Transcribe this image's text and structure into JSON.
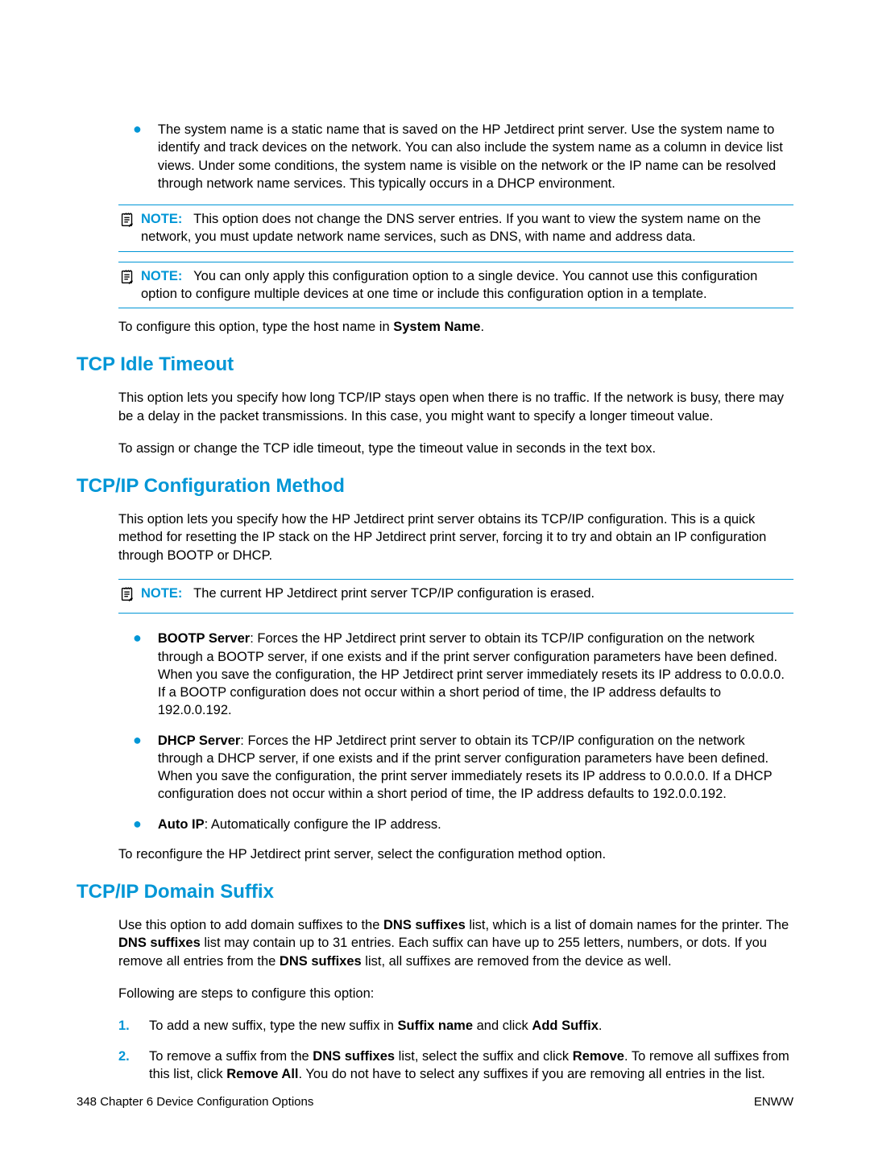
{
  "intro_bullet": "The system name is a static name that is saved on the HP Jetdirect print server. Use the system name to identify and track devices on the network. You can also include the system name as a column in device list views. Under some conditions, the system name is visible on the network or the IP name can be resolved through network name services. This typically occurs in a DHCP environment.",
  "note1_label": "NOTE:",
  "note1_text": "This option does not change the DNS server entries. If you want to view the system name on the network, you must update network name services, such as DNS, with name and address data.",
  "note2_label": "NOTE:",
  "note2_text": "You can only apply this configuration option to a single device. You cannot use this configuration option to configure multiple devices at one time or include this configuration option in a template.",
  "para_configure_pre": "To configure this option, type the host name in ",
  "para_configure_bold": "System Name",
  "para_configure_post": ".",
  "h_idle": "TCP Idle Timeout",
  "idle_p1": "This option lets you specify how long TCP/IP stays open when there is no traffic. If the network is busy, there may be a delay in the packet transmissions. In this case, you might want to specify a longer timeout value.",
  "idle_p2": "To assign or change the TCP idle timeout, type the timeout value in seconds in the text box.",
  "h_config": "TCP/IP Configuration Method",
  "config_p1": "This option lets you specify how the HP Jetdirect print server obtains its TCP/IP configuration. This is a quick method for resetting the IP stack on the HP Jetdirect print server, forcing it to try and obtain an IP configuration through BOOTP or DHCP.",
  "note3_label": "NOTE:",
  "note3_text": "The current HP Jetdirect print server TCP/IP configuration is erased.",
  "b1_bold": "BOOTP Server",
  "b1_text": ": Forces the HP Jetdirect print server to obtain its TCP/IP configuration on the network through a BOOTP server, if one exists and if the print server configuration parameters have been defined. When you save the configuration, the HP Jetdirect print server immediately resets its IP address to 0.0.0.0. If a BOOTP configuration does not occur within a short period of time, the IP address defaults to 192.0.0.192.",
  "b2_bold": "DHCP Server",
  "b2_text": ": Forces the HP Jetdirect print server to obtain its TCP/IP configuration on the network through a DHCP server, if one exists and if the print server configuration parameters have been defined. When you save the configuration, the print server immediately resets its IP address to 0.0.0.0. If a DHCP configuration does not occur within a short period of time, the IP address defaults to 192.0.0.192.",
  "b3_bold": "Auto IP",
  "b3_text": ": Automatically configure the IP address.",
  "config_p2": "To reconfigure the HP Jetdirect print server, select the configuration method option.",
  "h_suffix": "TCP/IP Domain Suffix",
  "suffix_p1_a": "Use this option to add domain suffixes to the ",
  "suffix_p1_b": "DNS suffixes",
  "suffix_p1_c": " list, which is a list of domain names for the printer. The ",
  "suffix_p1_d": "DNS suffixes",
  "suffix_p1_e": " list may contain up to 31 entries. Each suffix can have up to 255 letters, numbers, or dots. If you remove all entries from the ",
  "suffix_p1_f": "DNS suffixes",
  "suffix_p1_g": " list, all suffixes are removed from the device as well.",
  "suffix_p2": "Following are steps to configure this option:",
  "s1_num": "1.",
  "s1_a": "To add a new suffix, type the new suffix in ",
  "s1_b": "Suffix name",
  "s1_c": " and click ",
  "s1_d": "Add Suffix",
  "s1_e": ".",
  "s2_num": "2.",
  "s2_a": "To remove a suffix from the ",
  "s2_b": "DNS suffixes",
  "s2_c": " list, select the suffix and click ",
  "s2_d": "Remove",
  "s2_e": ". To remove all suffixes from this list, click ",
  "s2_f": "Remove All",
  "s2_g": ". You do not have to select any suffixes if you are removing all entries in the list.",
  "footer_left": "348   Chapter 6   Device Configuration Options",
  "footer_right": "ENWW"
}
